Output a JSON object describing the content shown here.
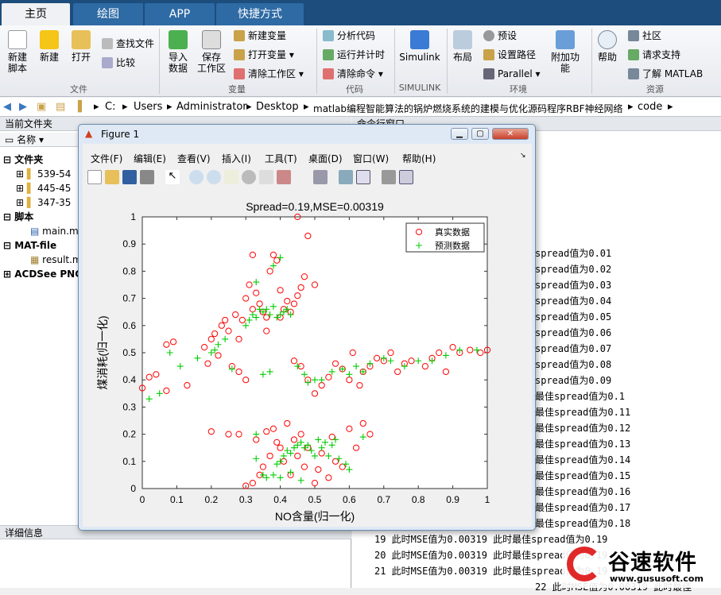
{
  "tabs": [
    "主页",
    "绘图",
    "APP",
    "快捷方式"
  ],
  "ribbon": {
    "file": {
      "new_script": "新建\n脚本",
      "new": "新建",
      "open": "打开",
      "find_files": "查找文件",
      "compare": "比较",
      "group": "文件"
    },
    "variable": {
      "import": "导入\n数据",
      "save_ws": "保存\n工作区",
      "new_var": "新建变量",
      "open_var": "打开变量",
      "clear_ws": "清除工作区",
      "group": "变量"
    },
    "code": {
      "analyze": "分析代码",
      "run_time": "运行并计时",
      "clear_cmd": "清除命令",
      "group": "代码"
    },
    "simulink": {
      "label": "Simulink",
      "group": "SIMULINK"
    },
    "env": {
      "layout": "布局",
      "prefs": "预设",
      "set_path": "设置路径",
      "parallel": "Parallel",
      "addons": "附加功能",
      "group": "环境"
    },
    "resources": {
      "help": "帮助",
      "community": "社区",
      "request": "请求支持",
      "learn": "了解 MATLAB",
      "group": "资源"
    }
  },
  "address": [
    "C:",
    "Users",
    "Administrator",
    "Desktop",
    "matlab编程智能算法的锅炉燃烧系统的建模与优化源码程序RBF神经网络",
    "code"
  ],
  "left_panel": {
    "title": "当前文件夹",
    "col_name": "名称",
    "folders_label": "文件夹",
    "folders": [
      "539-54",
      "445-45",
      "347-35"
    ],
    "scripts_label": "脚本",
    "script_file": "main.m",
    "matfile_label": "MAT-file",
    "mat_file": "result.m",
    "acdsee_label": "ACDSee PNG",
    "details_title": "详细信息"
  },
  "command": {
    "title": "命令行窗口",
    "lines": [
      "spread值为0.01",
      "spread值为0.02",
      "spread值为0.03",
      "spread值为0.04",
      "spread值为0.05",
      "spread值为0.06",
      "spread值为0.07",
      "spread值为0.08",
      "spread值为0.09",
      "最佳spread值为0.1",
      "最佳spread值为0.11",
      "最佳spread值为0.12",
      "最佳spread值为0.13",
      "最佳spread值为0.14",
      "最佳spread值为0.15",
      "最佳spread值为0.16",
      "最佳spread值为0.17",
      "最佳spread值为0.18",
      "19  此时MSE值为0.00319    此时最佳spread值为0.19",
      "20  此时MSE值为0.00319    此时最佳spread值为0.19",
      "21  此时MSE值为0.00319    此时最佳spread值为0.19",
      "22  此时MSE值为0.00319    此时最佳"
    ]
  },
  "figure": {
    "window_title": "Figure 1",
    "menus": [
      "文件(F)",
      "编辑(E)",
      "查看(V)",
      "插入(I)",
      "工具(T)",
      "桌面(D)",
      "窗口(W)",
      "帮助(H)"
    ]
  },
  "watermark": {
    "brand": "谷速软件",
    "url": "www.gususoft.com"
  },
  "chart_data": {
    "type": "scatter",
    "title": "Spread=0.19,MSE=0.00319",
    "xlabel": "NO含量(归一化)",
    "ylabel": "煤消耗(归一化)",
    "xlim": [
      0,
      1
    ],
    "ylim": [
      0,
      1
    ],
    "xticks": [
      "0",
      "0.1",
      "0.2",
      "0.3",
      "0.4",
      "0.5",
      "0.6",
      "0.7",
      "0.8",
      "0.9",
      "1"
    ],
    "yticks": [
      "0",
      "0.1",
      "0.2",
      "0.3",
      "0.4",
      "0.5",
      "0.6",
      "0.7",
      "0.8",
      "0.9",
      "1"
    ],
    "legend_position": "top-right",
    "series": [
      {
        "name": "真实数据",
        "marker": "circle",
        "color": "#ff0000",
        "points": [
          [
            0.0,
            0.37
          ],
          [
            0.02,
            0.41
          ],
          [
            0.04,
            0.42
          ],
          [
            0.07,
            0.36
          ],
          [
            0.07,
            0.53
          ],
          [
            0.09,
            0.54
          ],
          [
            0.13,
            0.38
          ],
          [
            0.18,
            0.52
          ],
          [
            0.19,
            0.46
          ],
          [
            0.2,
            0.55
          ],
          [
            0.21,
            0.57
          ],
          [
            0.22,
            0.49
          ],
          [
            0.23,
            0.6
          ],
          [
            0.24,
            0.62
          ],
          [
            0.25,
            0.58
          ],
          [
            0.27,
            0.64
          ],
          [
            0.28,
            0.55
          ],
          [
            0.29,
            0.62
          ],
          [
            0.3,
            0.7
          ],
          [
            0.31,
            0.75
          ],
          [
            0.32,
            0.66
          ],
          [
            0.33,
            0.72
          ],
          [
            0.34,
            0.68
          ],
          [
            0.35,
            0.65
          ],
          [
            0.36,
            0.63
          ],
          [
            0.37,
            0.8
          ],
          [
            0.38,
            0.86
          ],
          [
            0.39,
            0.84
          ],
          [
            0.4,
            0.73
          ],
          [
            0.41,
            0.66
          ],
          [
            0.42,
            0.69
          ],
          [
            0.43,
            0.65
          ],
          [
            0.44,
            0.68
          ],
          [
            0.45,
            0.71
          ],
          [
            0.46,
            0.74
          ],
          [
            0.47,
            0.78
          ],
          [
            0.48,
            0.93
          ],
          [
            0.45,
            1.0
          ],
          [
            0.5,
            0.75
          ],
          [
            0.32,
            0.86
          ],
          [
            0.36,
            0.58
          ],
          [
            0.4,
            0.63
          ],
          [
            0.26,
            0.45
          ],
          [
            0.28,
            0.43
          ],
          [
            0.3,
            0.4
          ],
          [
            0.44,
            0.47
          ],
          [
            0.46,
            0.45
          ],
          [
            0.48,
            0.4
          ],
          [
            0.5,
            0.35
          ],
          [
            0.52,
            0.38
          ],
          [
            0.54,
            0.41
          ],
          [
            0.56,
            0.46
          ],
          [
            0.58,
            0.44
          ],
          [
            0.6,
            0.4
          ],
          [
            0.61,
            0.5
          ],
          [
            0.63,
            0.38
          ],
          [
            0.64,
            0.43
          ],
          [
            0.66,
            0.45
          ],
          [
            0.68,
            0.48
          ],
          [
            0.7,
            0.47
          ],
          [
            0.72,
            0.5
          ],
          [
            0.74,
            0.43
          ],
          [
            0.76,
            0.46
          ],
          [
            0.78,
            0.47
          ],
          [
            0.82,
            0.45
          ],
          [
            0.84,
            0.48
          ],
          [
            0.86,
            0.5
          ],
          [
            0.88,
            0.43
          ],
          [
            0.9,
            0.52
          ],
          [
            0.92,
            0.5
          ],
          [
            0.95,
            0.51
          ],
          [
            0.98,
            0.5
          ],
          [
            1.0,
            0.51
          ],
          [
            0.2,
            0.21
          ],
          [
            0.25,
            0.2
          ],
          [
            0.28,
            0.2
          ],
          [
            0.3,
            0.01
          ],
          [
            0.32,
            0.02
          ],
          [
            0.33,
            0.18
          ],
          [
            0.34,
            0.05
          ],
          [
            0.35,
            0.08
          ],
          [
            0.37,
            0.12
          ],
          [
            0.38,
            0.22
          ],
          [
            0.4,
            0.15
          ],
          [
            0.41,
            0.1
          ],
          [
            0.43,
            0.05
          ],
          [
            0.44,
            0.18
          ],
          [
            0.45,
            0.12
          ],
          [
            0.46,
            0.2
          ],
          [
            0.47,
            0.08
          ],
          [
            0.48,
            0.15
          ],
          [
            0.5,
            0.02
          ],
          [
            0.51,
            0.07
          ],
          [
            0.52,
            0.13
          ],
          [
            0.54,
            0.04
          ],
          [
            0.55,
            0.19
          ],
          [
            0.56,
            0.1
          ],
          [
            0.58,
            0.08
          ],
          [
            0.6,
            0.22
          ],
          [
            0.62,
            0.15
          ],
          [
            0.64,
            0.24
          ],
          [
            0.66,
            0.2
          ],
          [
            0.36,
            0.21
          ],
          [
            0.39,
            0.17
          ],
          [
            0.42,
            0.24
          ]
        ]
      },
      {
        "name": "预测数据",
        "marker": "plus",
        "color": "#00cc00",
        "points": [
          [
            0.02,
            0.33
          ],
          [
            0.05,
            0.35
          ],
          [
            0.08,
            0.5
          ],
          [
            0.11,
            0.45
          ],
          [
            0.16,
            0.48
          ],
          [
            0.2,
            0.5
          ],
          [
            0.21,
            0.51
          ],
          [
            0.22,
            0.53
          ],
          [
            0.24,
            0.55
          ],
          [
            0.26,
            0.44
          ],
          [
            0.3,
            0.6
          ],
          [
            0.31,
            0.62
          ],
          [
            0.32,
            0.64
          ],
          [
            0.33,
            0.63
          ],
          [
            0.34,
            0.66
          ],
          [
            0.35,
            0.65
          ],
          [
            0.36,
            0.66
          ],
          [
            0.37,
            0.64
          ],
          [
            0.38,
            0.67
          ],
          [
            0.39,
            0.63
          ],
          [
            0.4,
            0.64
          ],
          [
            0.41,
            0.65
          ],
          [
            0.42,
            0.66
          ],
          [
            0.43,
            0.64
          ],
          [
            0.38,
            0.82
          ],
          [
            0.4,
            0.85
          ],
          [
            0.33,
            0.76
          ],
          [
            0.35,
            0.42
          ],
          [
            0.37,
            0.43
          ],
          [
            0.45,
            0.45
          ],
          [
            0.47,
            0.42
          ],
          [
            0.48,
            0.39
          ],
          [
            0.5,
            0.4
          ],
          [
            0.52,
            0.4
          ],
          [
            0.55,
            0.43
          ],
          [
            0.58,
            0.44
          ],
          [
            0.6,
            0.42
          ],
          [
            0.62,
            0.45
          ],
          [
            0.64,
            0.43
          ],
          [
            0.66,
            0.46
          ],
          [
            0.7,
            0.48
          ],
          [
            0.72,
            0.47
          ],
          [
            0.76,
            0.45
          ],
          [
            0.8,
            0.47
          ],
          [
            0.84,
            0.47
          ],
          [
            0.88,
            0.49
          ],
          [
            0.92,
            0.51
          ],
          [
            0.97,
            0.51
          ],
          [
            0.33,
            0.2
          ],
          [
            0.33,
            0.11
          ],
          [
            0.35,
            0.05
          ],
          [
            0.36,
            0.04
          ],
          [
            0.38,
            0.05
          ],
          [
            0.39,
            0.09
          ],
          [
            0.4,
            0.1
          ],
          [
            0.41,
            0.12
          ],
          [
            0.42,
            0.14
          ],
          [
            0.43,
            0.13
          ],
          [
            0.44,
            0.15
          ],
          [
            0.45,
            0.16
          ],
          [
            0.46,
            0.17
          ],
          [
            0.47,
            0.15
          ],
          [
            0.48,
            0.16
          ],
          [
            0.49,
            0.14
          ],
          [
            0.5,
            0.12
          ],
          [
            0.51,
            0.18
          ],
          [
            0.52,
            0.15
          ],
          [
            0.53,
            0.17
          ],
          [
            0.54,
            0.12
          ],
          [
            0.55,
            0.16
          ],
          [
            0.56,
            0.18
          ],
          [
            0.57,
            0.11
          ],
          [
            0.59,
            0.09
          ],
          [
            0.6,
            0.07
          ],
          [
            0.64,
            0.19
          ],
          [
            0.4,
            0.04
          ],
          [
            0.43,
            0.06
          ],
          [
            0.46,
            0.03
          ]
        ]
      }
    ]
  }
}
